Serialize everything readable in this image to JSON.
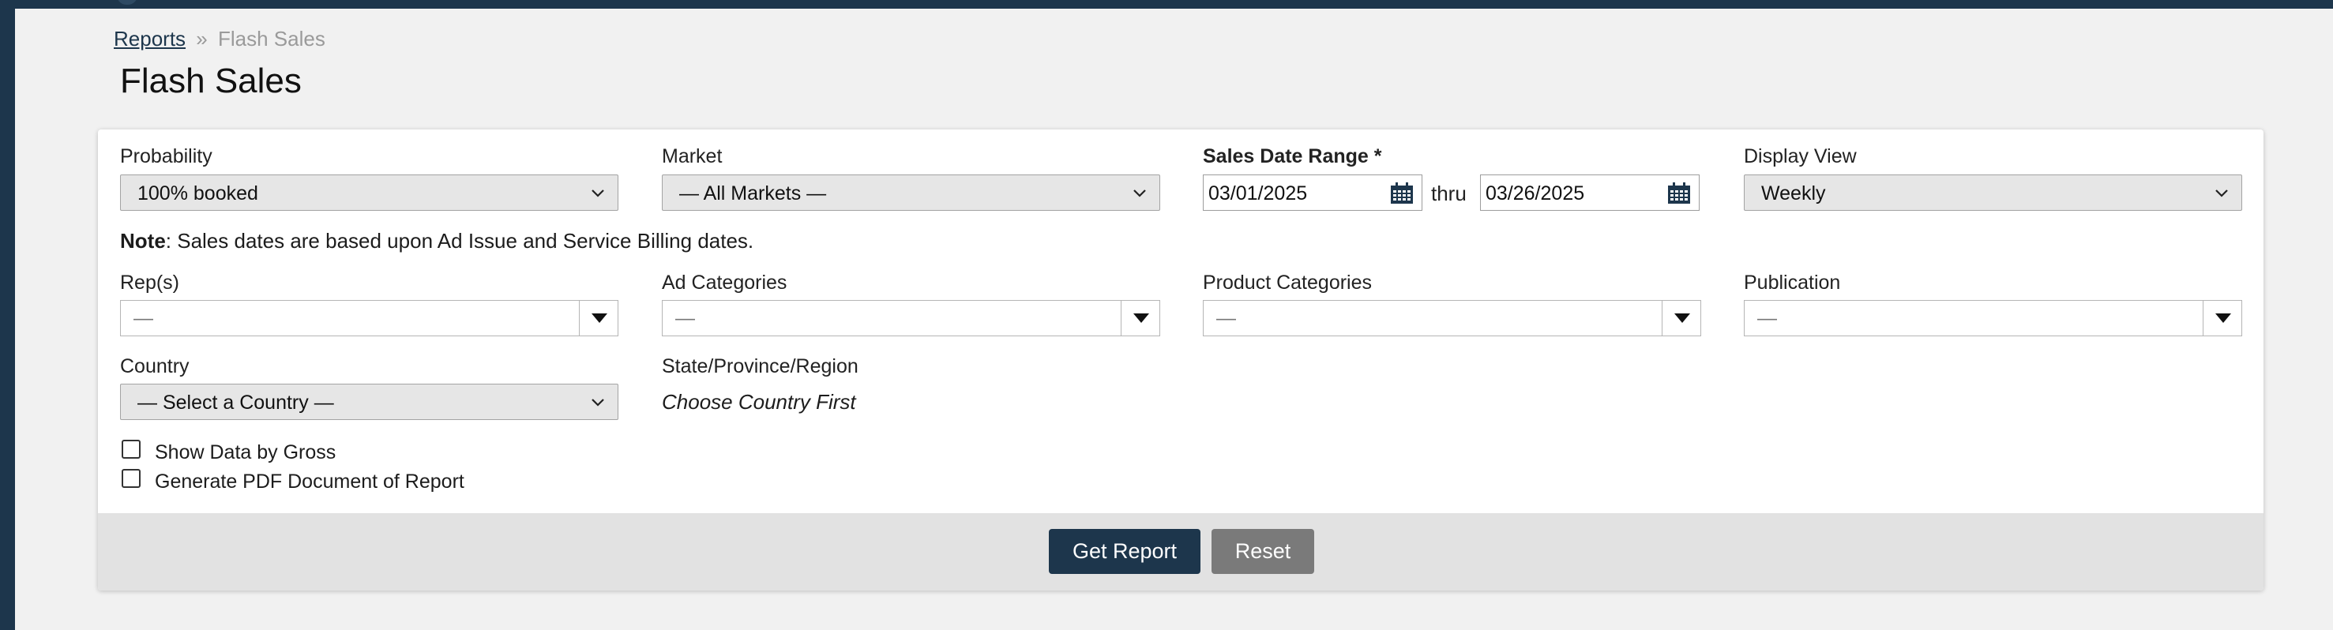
{
  "breadcrumb": {
    "parent": "Reports",
    "separator": "»",
    "current": "Flash Sales"
  },
  "page": {
    "title": "Flash Sales"
  },
  "filters": {
    "probability": {
      "label": "Probability",
      "value": "100% booked"
    },
    "market": {
      "label": "Market",
      "value": "— All Markets —"
    },
    "sales_date_range": {
      "label": "Sales Date Range *",
      "from": "03/01/2025",
      "joiner": "thru",
      "to": "03/26/2025"
    },
    "display_view": {
      "label": "Display View",
      "value": "Weekly"
    },
    "note": {
      "prefix": "Note",
      "text": ": Sales dates are based upon Ad Issue and Service Billing dates."
    },
    "reps": {
      "label": "Rep(s)",
      "value": "—"
    },
    "ad_categories": {
      "label": "Ad Categories",
      "value": "—"
    },
    "product_categories": {
      "label": "Product Categories",
      "value": "—"
    },
    "publication": {
      "label": "Publication",
      "value": "—"
    },
    "country": {
      "label": "Country",
      "value": "— Select a Country —"
    },
    "state": {
      "label": "State/Province/Region",
      "value": "Choose Country First"
    },
    "show_gross": {
      "label": "Show Data by Gross",
      "checked": false
    },
    "generate_pdf": {
      "label": "Generate PDF Document of Report",
      "checked": false
    }
  },
  "actions": {
    "get_report": "Get Report",
    "reset": "Reset"
  },
  "colors": {
    "brand": "#1d364c",
    "secondary_button": "#7a7a7a",
    "footer_bg": "#e2e2e2",
    "page_bg": "#f1f1f1"
  },
  "icons": {
    "dropdown": "chevron-down-icon",
    "calendar": "calendar-icon",
    "multiselect": "triangle-down-icon"
  }
}
